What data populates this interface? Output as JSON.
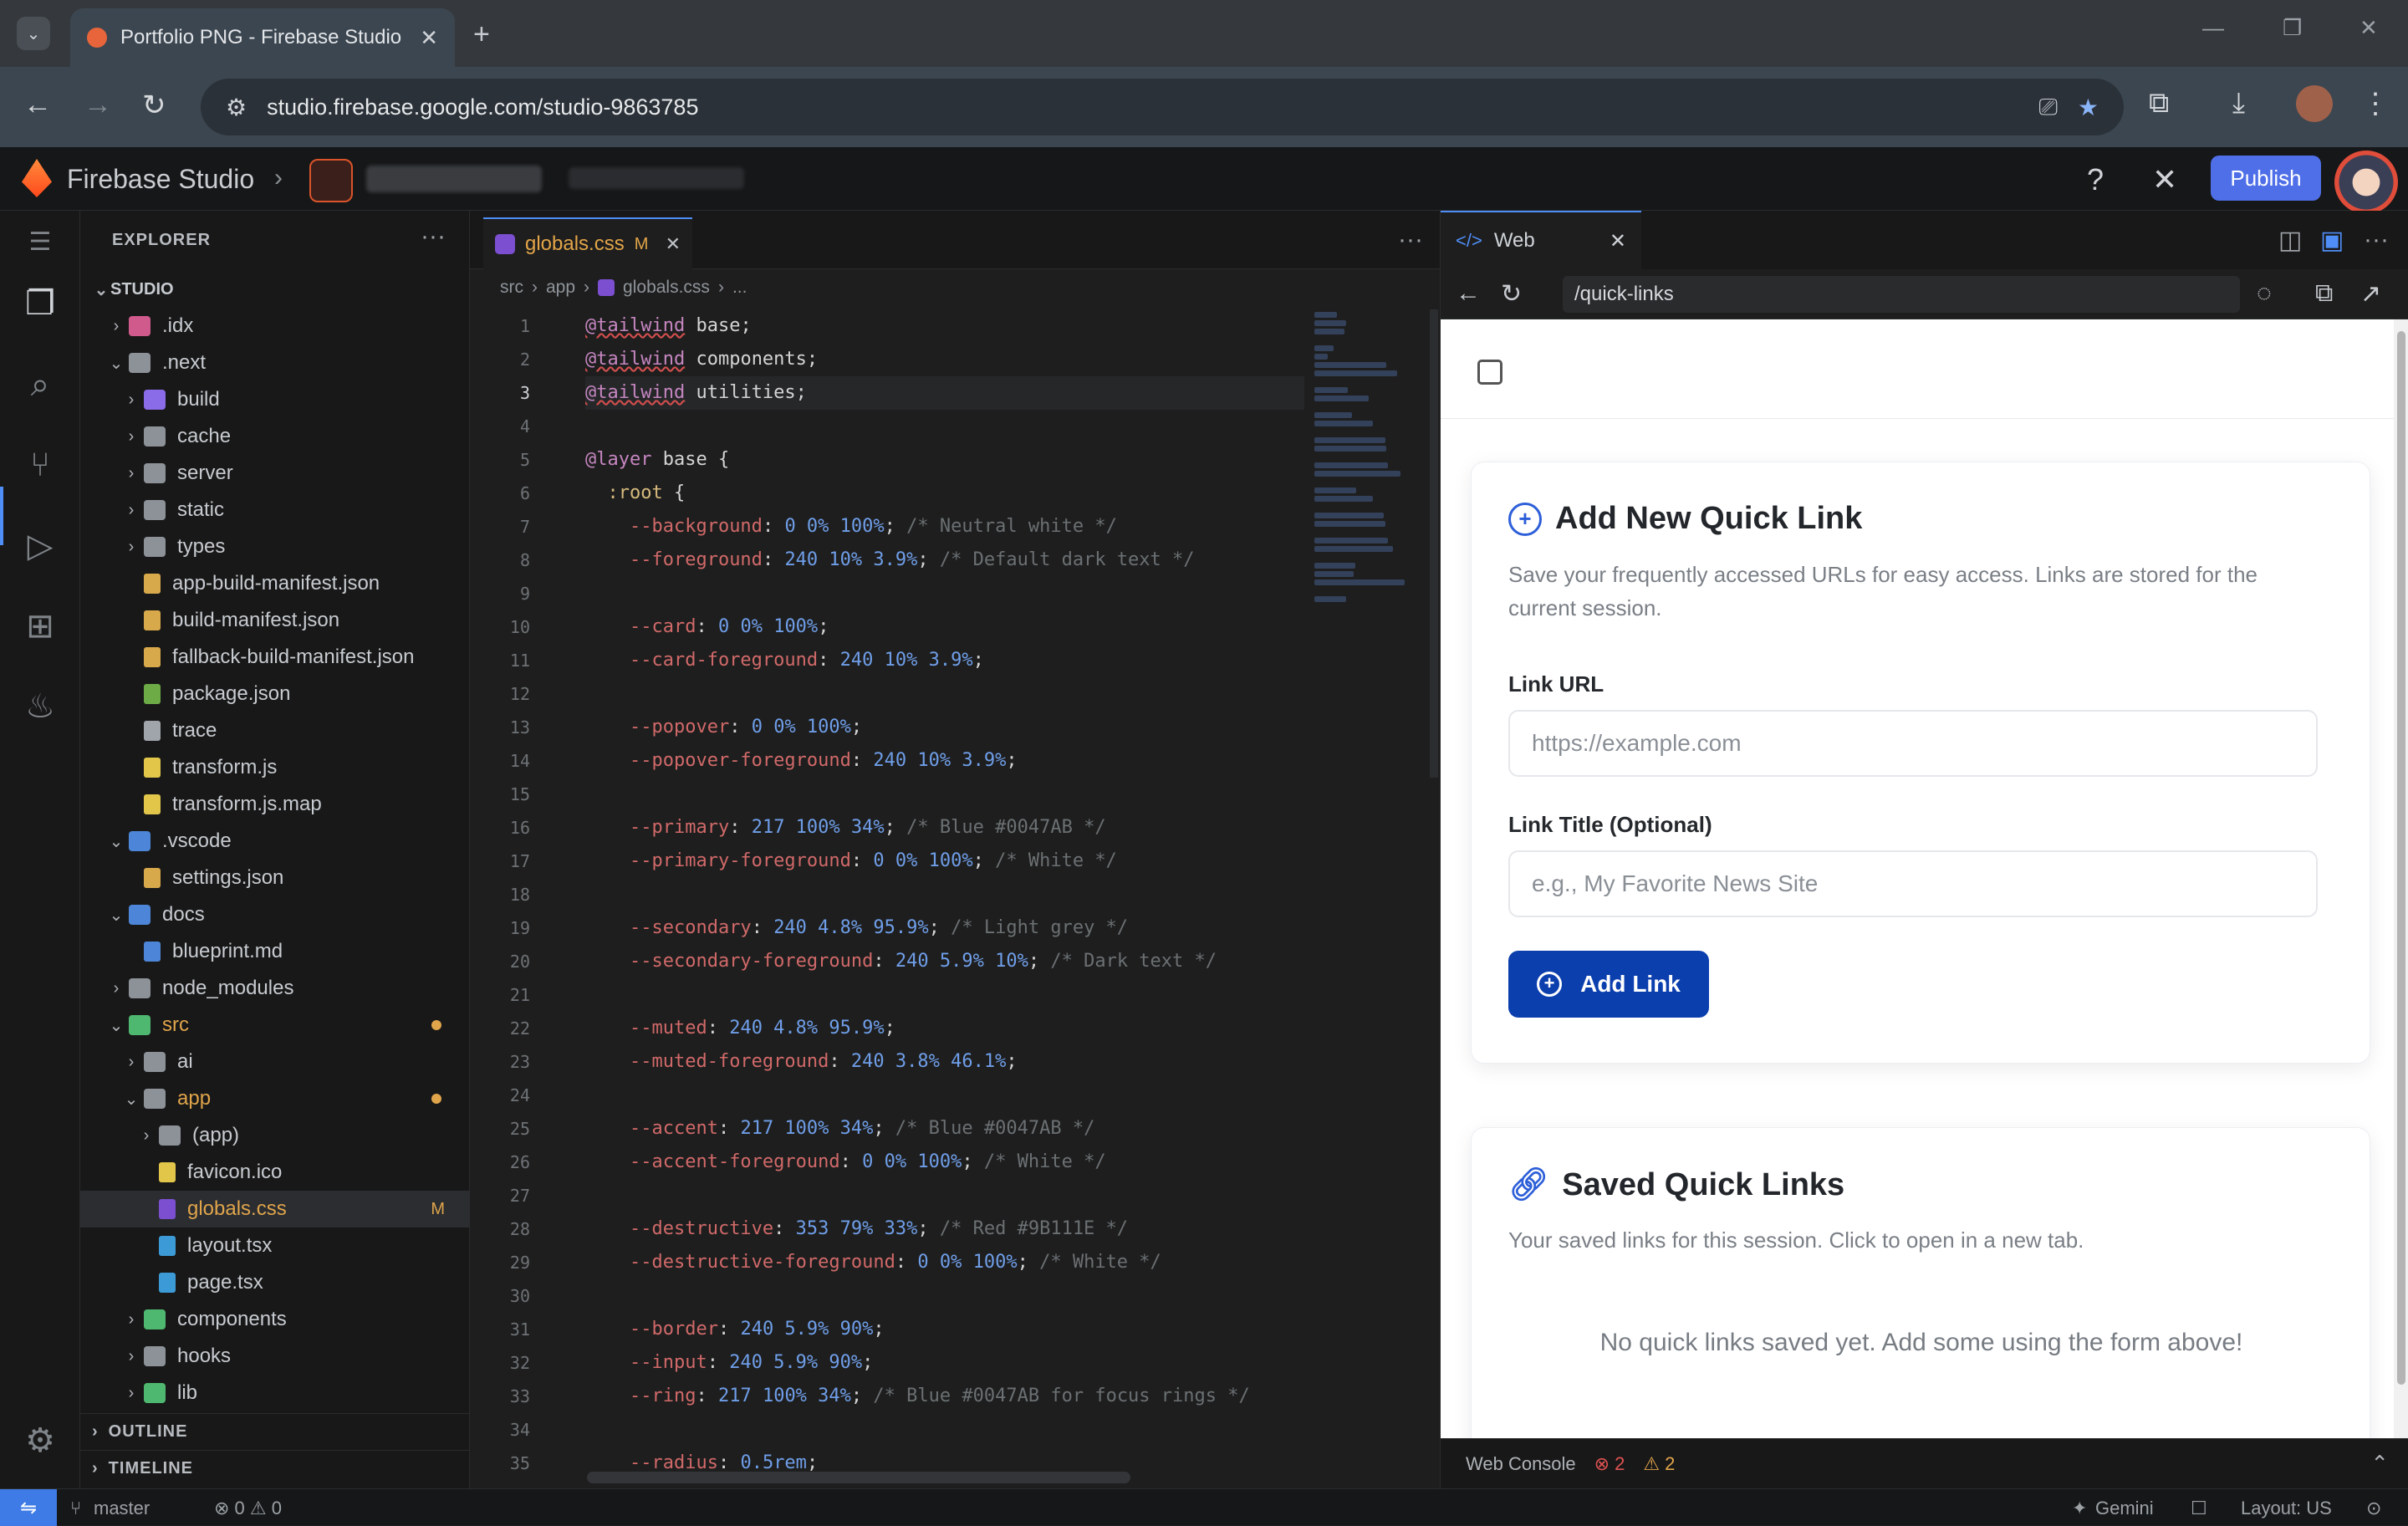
{
  "browser": {
    "tab_title": "Portfolio PNG - Firebase Studio",
    "url": "studio.firebase.google.com/studio-9863785",
    "win_min": "—",
    "win_max": "❐",
    "win_close": "✕"
  },
  "studio": {
    "brand": "Firebase Studio",
    "publish_label": "Publish"
  },
  "explorer": {
    "title": "EXPLORER",
    "tree": [
      {
        "label": "STUDIO",
        "depth": 0,
        "chev": "⌄",
        "kind": "root"
      },
      {
        "label": ".idx",
        "depth": 1,
        "chev": "›",
        "kind": "folder",
        "color": "#d05a8c"
      },
      {
        "label": ".next",
        "depth": 1,
        "chev": "⌄",
        "kind": "folder",
        "color": "#8d9299"
      },
      {
        "label": "build",
        "depth": 2,
        "chev": "›",
        "kind": "folder",
        "color": "#8a6be8"
      },
      {
        "label": "cache",
        "depth": 2,
        "chev": "›",
        "kind": "folder",
        "color": "#8d9299"
      },
      {
        "label": "server",
        "depth": 2,
        "chev": "›",
        "kind": "folder",
        "color": "#8d9299"
      },
      {
        "label": "static",
        "depth": 2,
        "chev": "›",
        "kind": "folder",
        "color": "#8d9299"
      },
      {
        "label": "types",
        "depth": 2,
        "chev": "›",
        "kind": "folder",
        "color": "#8d9299"
      },
      {
        "label": "app-build-manifest.json",
        "depth": 2,
        "chev": "",
        "kind": "file",
        "color": "#d8a94a"
      },
      {
        "label": "build-manifest.json",
        "depth": 2,
        "chev": "",
        "kind": "file",
        "color": "#d8a94a"
      },
      {
        "label": "fallback-build-manifest.json",
        "depth": 2,
        "chev": "",
        "kind": "file",
        "color": "#d8a94a"
      },
      {
        "label": "package.json",
        "depth": 2,
        "chev": "",
        "kind": "file",
        "color": "#6cab46"
      },
      {
        "label": "trace",
        "depth": 2,
        "chev": "",
        "kind": "file",
        "color": "#a0a5ab"
      },
      {
        "label": "transform.js",
        "depth": 2,
        "chev": "",
        "kind": "file",
        "color": "#e1c64a"
      },
      {
        "label": "transform.js.map",
        "depth": 2,
        "chev": "",
        "kind": "file",
        "color": "#e1c64a"
      },
      {
        "label": ".vscode",
        "depth": 1,
        "chev": "⌄",
        "kind": "folder",
        "color": "#4d86d8"
      },
      {
        "label": "settings.json",
        "depth": 2,
        "chev": "",
        "kind": "file",
        "color": "#d8a94a"
      },
      {
        "label": "docs",
        "depth": 1,
        "chev": "⌄",
        "kind": "folder",
        "color": "#4d86d8"
      },
      {
        "label": "blueprint.md",
        "depth": 2,
        "chev": "",
        "kind": "file",
        "color": "#4d86d8"
      },
      {
        "label": "node_modules",
        "depth": 1,
        "chev": "›",
        "kind": "folder",
        "color": "#8d9299"
      },
      {
        "label": "src",
        "depth": 1,
        "chev": "⌄",
        "kind": "folder",
        "color": "#4fb870",
        "mod": "dot",
        "labelColor": "#e0a44b"
      },
      {
        "label": "ai",
        "depth": 2,
        "chev": "›",
        "kind": "folder",
        "color": "#8d9299"
      },
      {
        "label": "app",
        "depth": 2,
        "chev": "⌄",
        "kind": "folder",
        "color": "#8d9299",
        "mod": "dot",
        "labelColor": "#e0a44b"
      },
      {
        "label": "(app)",
        "depth": 3,
        "chev": "›",
        "kind": "folder",
        "color": "#8d9299"
      },
      {
        "label": "favicon.ico",
        "depth": 3,
        "chev": "",
        "kind": "file",
        "color": "#e1c64a"
      },
      {
        "label": "globals.css",
        "depth": 3,
        "chev": "",
        "kind": "file",
        "color": "#7b4fd0",
        "mod": "M",
        "labelColor": "#e0a44b",
        "selected": true
      },
      {
        "label": "layout.tsx",
        "depth": 3,
        "chev": "",
        "kind": "file",
        "color": "#3c9bd6"
      },
      {
        "label": "page.tsx",
        "depth": 3,
        "chev": "",
        "kind": "file",
        "color": "#3c9bd6"
      },
      {
        "label": "components",
        "depth": 2,
        "chev": "›",
        "kind": "folder",
        "color": "#4fb870"
      },
      {
        "label": "hooks",
        "depth": 2,
        "chev": "›",
        "kind": "folder",
        "color": "#8d9299"
      },
      {
        "label": "lib",
        "depth": 2,
        "chev": "›",
        "kind": "folder",
        "color": "#4fb870"
      }
    ],
    "outline": "OUTLINE",
    "timeline": "TIMELINE"
  },
  "editor": {
    "tab_name": "globals.css",
    "tab_mod": "M",
    "breadcrumb": [
      "src",
      "app",
      "globals.css",
      "..."
    ],
    "lines": [
      "@tailwind base;",
      "@tailwind components;",
      "@tailwind utilities;",
      "",
      "@layer base {",
      "  :root {",
      "    --background: 0 0% 100%; /* Neutral white */",
      "    --foreground: 240 10% 3.9%; /* Default dark text */",
      "",
      "    --card: 0 0% 100%;",
      "    --card-foreground: 240 10% 3.9%;",
      "",
      "    --popover: 0 0% 100%;",
      "    --popover-foreground: 240 10% 3.9%;",
      "",
      "    --primary: 217 100% 34%; /* Blue #0047AB */",
      "    --primary-foreground: 0 0% 100%; /* White */",
      "",
      "    --secondary: 240 4.8% 95.9%; /* Light grey */",
      "    --secondary-foreground: 240 5.9% 10%; /* Dark text */",
      "",
      "    --muted: 240 4.8% 95.9%;",
      "    --muted-foreground: 240 3.8% 46.1%;",
      "",
      "    --accent: 217 100% 34%; /* Blue #0047AB */",
      "    --accent-foreground: 0 0% 100%; /* White */",
      "",
      "    --destructive: 353 79% 33%; /* Red #9B111E */",
      "    --destructive-foreground: 0 0% 100%; /* White */",
      "",
      "    --border: 240 5.9% 90%;",
      "    --input: 240 5.9% 90%;",
      "    --ring: 217 100% 34%; /* Blue #0047AB for focus rings */",
      "",
      "    --radius: 0.5rem;"
    ],
    "current_line": 3
  },
  "web": {
    "tab_label": "Web",
    "path": "/quick-links",
    "add_card": {
      "title": "Add New Quick Link",
      "description": "Save your frequently accessed URLs for easy access. Links are stored for the current session.",
      "url_label": "Link URL",
      "url_placeholder": "https://example.com",
      "title_label": "Link Title (Optional)",
      "title_placeholder": "e.g., My Favorite News Site",
      "button": "Add Link"
    },
    "saved_card": {
      "title": "Saved Quick Links",
      "description": "Your saved links for this session. Click to open in a new tab.",
      "empty": "No quick links saved yet. Add some using the form above!"
    },
    "console": {
      "label": "Web Console",
      "errors": "2",
      "warnings": "2"
    }
  },
  "status": {
    "branch": "master",
    "problems": "⊗ 0 ⚠ 0",
    "gemini": "Gemini",
    "layout": "Layout: US"
  }
}
